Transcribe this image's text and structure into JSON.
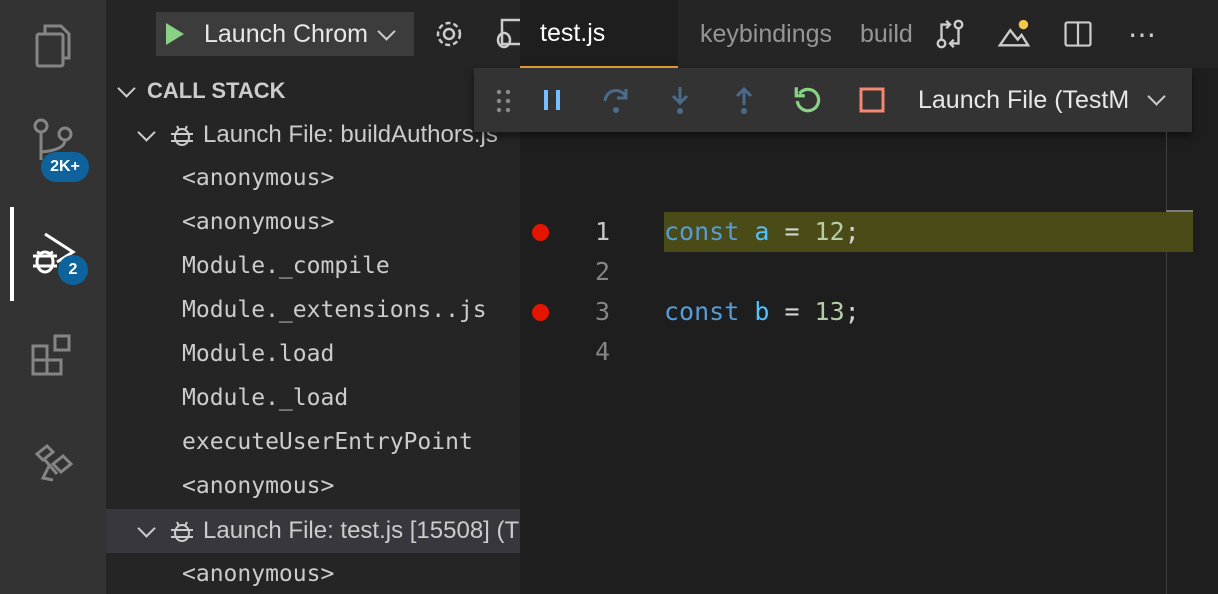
{
  "activity_bar": {
    "items": [
      "explorer",
      "source-control",
      "run-and-debug",
      "extensions",
      "remote-explorer"
    ],
    "scm_badge": "2K+",
    "debug_badge": "2"
  },
  "sidebar": {
    "launch_config": "Launch Chrom",
    "section_title": "CALL STACK",
    "threads": [
      {
        "label": "Launch File: buildAuthors.js",
        "frames": [
          "<anonymous>",
          "<anonymous>",
          "Module._compile",
          "Module._extensions..js",
          "Module.load",
          "Module._load",
          "executeUserEntryPoint",
          "<anonymous>"
        ]
      },
      {
        "label": "Launch File: test.js [15508] (T",
        "frames": [
          "<anonymous>"
        ]
      }
    ]
  },
  "tabs": [
    {
      "label": "test.js",
      "active": true
    },
    {
      "label": "keybindings",
      "active": false
    },
    {
      "label": "build",
      "active": false
    }
  ],
  "debug_toolbar": {
    "config": "Launch File (TestM",
    "buttons": [
      "pause",
      "step-over",
      "step-into",
      "step-out",
      "restart",
      "stop"
    ]
  },
  "editor": {
    "lines": [
      {
        "number": "1",
        "breakpoint": true,
        "current": true,
        "keyword": "const",
        "name": "a",
        "op": " = ",
        "value": "12",
        "end": ";"
      },
      {
        "number": "2",
        "breakpoint": false,
        "current": false
      },
      {
        "number": "3",
        "breakpoint": true,
        "current": false,
        "keyword": "const",
        "name": "b",
        "op": " = ",
        "value": "13",
        "end": ";"
      },
      {
        "number": "4",
        "breakpoint": false,
        "current": false
      }
    ]
  },
  "colors": {
    "breakpoint": "#e51400",
    "current_line": "#4b4b18",
    "badge": "#0e639c",
    "accent_tab": "#e8a23a"
  }
}
